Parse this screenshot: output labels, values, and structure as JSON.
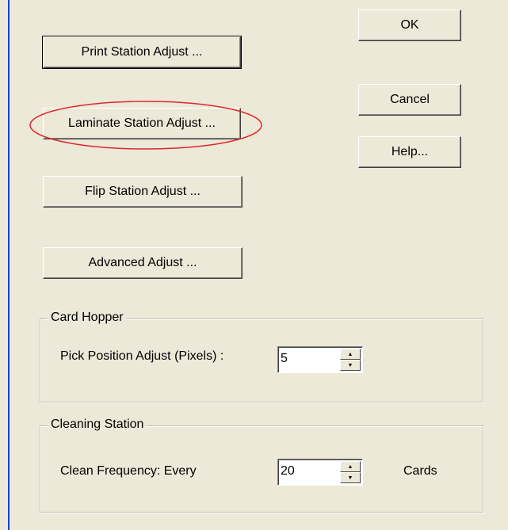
{
  "buttons": {
    "print_station": "Print Station Adjust ...",
    "laminate_station": "Laminate Station Adjust ...",
    "flip_station": "Flip Station Adjust ...",
    "advanced": "Advanced Adjust ...",
    "ok": "OK",
    "cancel": "Cancel",
    "help": "Help..."
  },
  "card_hopper": {
    "title": "Card Hopper",
    "label": "Pick Position Adjust (Pixels) :",
    "value": "5"
  },
  "cleaning_station": {
    "title": "Cleaning Station",
    "label": "Clean Frequency: Every",
    "value": "20",
    "unit": "Cards"
  },
  "icons": {
    "spin_up": "spin-up-arrow-icon",
    "spin_down": "spin-down-arrow-icon"
  },
  "colors": {
    "annotation": "#e0262b",
    "window_border": "#0046d5",
    "dialog_bg": "#ece9d8"
  }
}
